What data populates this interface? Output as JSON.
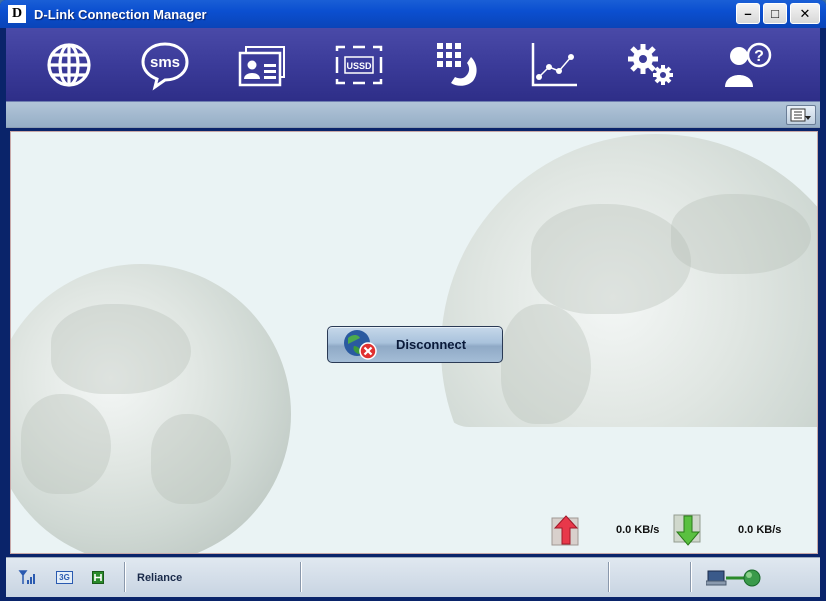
{
  "window": {
    "title": "D-Link Connection Manager",
    "logo_letter": "D",
    "minimize_label": "–",
    "maximize_label": "□",
    "close_label": "✕"
  },
  "toolbar": {
    "items": [
      {
        "id": "internet",
        "icon": "globe-icon"
      },
      {
        "id": "sms",
        "icon": "sms-icon",
        "icon_text": "sms"
      },
      {
        "id": "contacts",
        "icon": "contacts-icon"
      },
      {
        "id": "ussd",
        "icon": "ussd-icon",
        "icon_text": "USSD"
      },
      {
        "id": "dialer",
        "icon": "phone-dialpad-icon"
      },
      {
        "id": "statistics",
        "icon": "statistics-chart-icon"
      },
      {
        "id": "settings",
        "icon": "settings-gears-icon"
      },
      {
        "id": "help",
        "icon": "help-user-icon"
      }
    ],
    "accent_color": "#3b3b99"
  },
  "main": {
    "disconnect_label": "Disconnect",
    "upload_rate": "0.0 KB/s",
    "download_rate": "0.0 KB/s"
  },
  "status": {
    "network_type": "3G",
    "operator": "Reliance"
  }
}
